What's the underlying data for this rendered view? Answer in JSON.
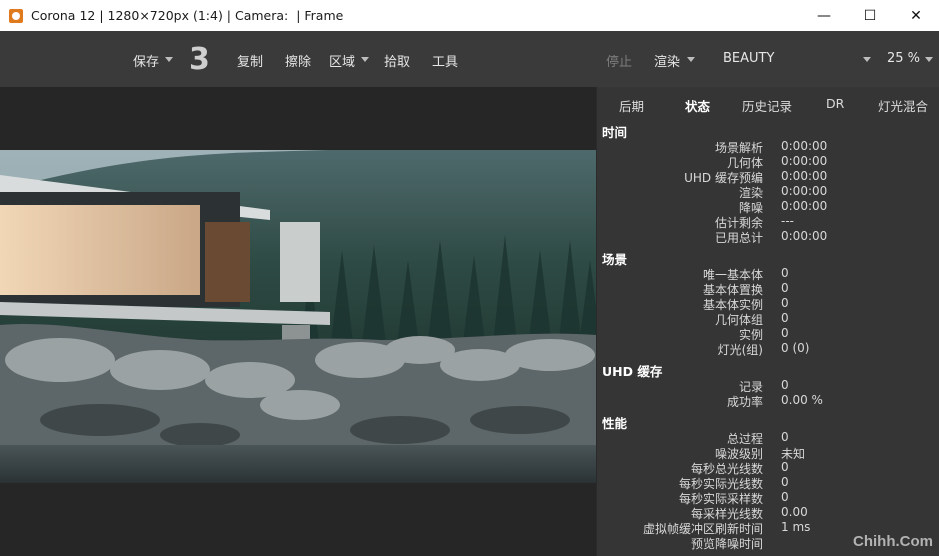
{
  "window": {
    "title": "Corona 12 | 1280×720px (1:4) | Camera:  | Frame",
    "minimize": "—",
    "maximize": "☐",
    "close": "✕"
  },
  "toolbar": {
    "save": "保存",
    "pass_number": "3",
    "copy": "复制",
    "erase": "擦除",
    "region": "区域",
    "pick": "拾取",
    "tools": "工具",
    "stop": "停止",
    "render": "渲染",
    "channel": "BEAUTY",
    "zoom": "25 %"
  },
  "tabs": [
    "后期",
    "状态",
    "历史记录",
    "DR",
    "灯光混合"
  ],
  "active_tab": "状态",
  "stats": {
    "time": {
      "header": "时间",
      "rows": [
        {
          "label": "场景解析",
          "value": "0:00:00"
        },
        {
          "label": "几何体",
          "value": "0:00:00"
        },
        {
          "label": "UHD 缓存预编",
          "value": "0:00:00"
        },
        {
          "label": "渲染",
          "value": "0:00:00"
        },
        {
          "label": "降噪",
          "value": "0:00:00"
        },
        {
          "label": "估计剩余",
          "value": "---"
        },
        {
          "label": "已用总计",
          "value": "0:00:00"
        }
      ]
    },
    "scene": {
      "header": "场景",
      "rows": [
        {
          "label": "唯一基本体",
          "value": "0"
        },
        {
          "label": "基本体置换",
          "value": "0"
        },
        {
          "label": "基本体实例",
          "value": "0"
        },
        {
          "label": "几何体组",
          "value": "0"
        },
        {
          "label": "实例",
          "value": "0"
        },
        {
          "label": "灯光(组)",
          "value": "0 (0)"
        }
      ]
    },
    "uhd": {
      "header": "UHD 缓存",
      "rows": [
        {
          "label": "记录",
          "value": "0"
        },
        {
          "label": "成功率",
          "value": "0.00 %"
        }
      ]
    },
    "perf": {
      "header": "性能",
      "rows": [
        {
          "label": "总过程",
          "value": "0"
        },
        {
          "label": "噪波级别",
          "value": "未知"
        },
        {
          "label": "每秒总光线数",
          "value": "0"
        },
        {
          "label": "每秒实际光线数",
          "value": "0"
        },
        {
          "label": "每秒实际采样数",
          "value": "0"
        },
        {
          "label": "每采样光线数",
          "value": "0.00"
        },
        {
          "label": "虚拟帧缓冲区刷新时间",
          "value": "1 ms"
        },
        {
          "label": "预览降噪时间",
          "value": ""
        }
      ]
    }
  },
  "watermark": "Chihh.Com",
  "colors": {
    "titlebar": "#ffffff",
    "toolbar": "#3a3a3a",
    "panel": "#353535",
    "viewport": "#262626",
    "accent": "#e07a1f"
  }
}
